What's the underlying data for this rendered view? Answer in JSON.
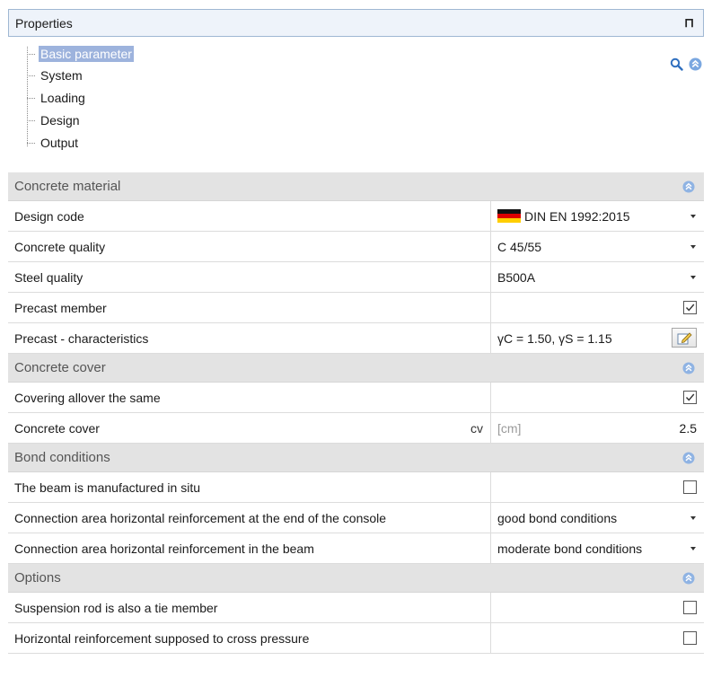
{
  "panel": {
    "title": "Properties"
  },
  "tree": [
    {
      "label": "Basic parameter",
      "selected": true
    },
    {
      "label": "System",
      "selected": false
    },
    {
      "label": "Loading",
      "selected": false
    },
    {
      "label": "Design",
      "selected": false
    },
    {
      "label": "Output",
      "selected": false
    }
  ],
  "sections": {
    "concrete_material": {
      "title": "Concrete material",
      "design_code": {
        "label": "Design code",
        "value": "DIN EN 1992:2015"
      },
      "concrete_quality": {
        "label": "Concrete quality",
        "value": "C 45/55"
      },
      "steel_quality": {
        "label": "Steel quality",
        "value": "B500A"
      },
      "precast_member": {
        "label": "Precast member",
        "checked": true
      },
      "precast_char": {
        "label": "Precast - characteristics",
        "value": "γC = 1.50, γS = 1.15"
      }
    },
    "concrete_cover": {
      "title": "Concrete cover",
      "allover": {
        "label": "Covering allover the same",
        "checked": true
      },
      "cover": {
        "label": "Concrete cover",
        "symbol": "cv",
        "unit": "[cm]",
        "value": "2.5"
      }
    },
    "bond_conditions": {
      "title": "Bond conditions",
      "in_situ": {
        "label": "The beam is manufactured in situ",
        "checked": false
      },
      "conn_console": {
        "label": "Connection area horizontal reinforcement at the end of the console",
        "value": "good bond conditions"
      },
      "conn_beam": {
        "label": "Connection area horizontal reinforcement in the beam",
        "value": "moderate bond conditions"
      }
    },
    "options": {
      "title": "Options",
      "suspension": {
        "label": "Suspension rod is also a tie member",
        "checked": false
      },
      "horiz_cross": {
        "label": "Horizontal reinforcement supposed to cross pressure",
        "checked": false
      }
    }
  },
  "colors": {
    "selected_bg": "#9db3dd",
    "section_bg": "#e3e3e3",
    "accent": "#3a7fd1"
  }
}
